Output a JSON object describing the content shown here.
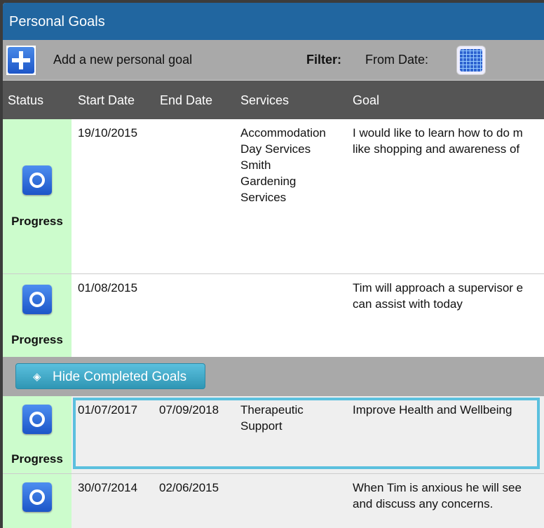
{
  "header": {
    "title": "Personal Goals"
  },
  "toolbar": {
    "add_label": "Add a new personal goal",
    "filter_label": "Filter:",
    "from_date_label": "From Date:"
  },
  "columns": [
    "Status",
    "Start Date",
    "End Date",
    "Services",
    "Goal"
  ],
  "rows": [
    {
      "status": "Progress",
      "start": "19/10/2015",
      "end": "",
      "services": [
        "Accommodation",
        "Day Services",
        "Smith",
        "Gardening",
        "Services"
      ],
      "goal": [
        "I would like to learn how to do m",
        "like shopping and awareness of"
      ]
    },
    {
      "status": "Progress",
      "start": "01/08/2015",
      "end": "",
      "services": [],
      "goal": [
        "Tim will approach a supervisor e",
        "can assist with today"
      ]
    },
    {
      "status": "Progress",
      "start": "01/07/2017",
      "end": "07/09/2018",
      "services": [
        "Therapeutic",
        "Support"
      ],
      "goal": [
        "Improve Health and Wellbeing"
      ]
    },
    {
      "status": "",
      "start": "30/07/2014",
      "end": "02/06/2015",
      "services": [],
      "goal": [
        "When Tim is anxious he will see",
        "and discuss any concerns."
      ]
    }
  ],
  "hide_button": "Hide Completed Goals",
  "colors": {
    "header": "#2166a0",
    "status_bg": "#ccfccc",
    "highlight": "#5bc0de"
  }
}
